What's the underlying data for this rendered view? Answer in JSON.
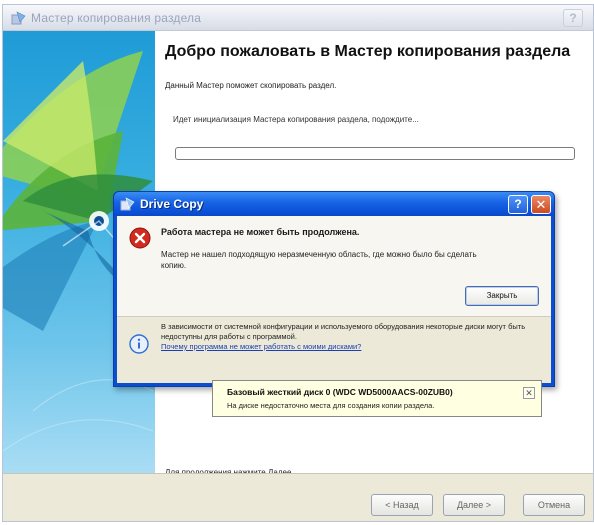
{
  "wizard": {
    "title": "Мастер копирования раздела",
    "heading": "Добро пожаловать в Мастер копирования раздела",
    "description": "Данный Мастер поможет скопировать раздел.",
    "init_status": "Идет инициализация Мастера копирования раздела, подождите...",
    "continue_text": "Для продолжения нажмите Далее",
    "help_icon": "?",
    "buttons": {
      "back": "< Назад",
      "next": "Далее >",
      "cancel": "Отмена"
    }
  },
  "dialog": {
    "title": "Drive Copy",
    "help_icon": "?",
    "close_icon": "✕",
    "error_heading": "Работа мастера не может быть продолжена.",
    "error_message": "Мастер не нашел подходящую неразмеченную область, где можно было бы сделать копию.",
    "close_button": "Закрыть",
    "info_text": "В зависимости от системной конфигурации и используемого оборудования некоторые диски могут быть недоступны для работы с программой.",
    "info_link": "Почему программа не может работать с моими дисками?"
  },
  "balloon": {
    "title": "Базовый жесткий диск 0 (WDC WD5000AACS-00ZUB0)",
    "text": "На диске недостаточно места для создания копии раздела.",
    "close_icon": "✕"
  },
  "colors": {
    "dialog_titlebar": "#0b52d8",
    "banner": "#1f9bd6",
    "balloon_bg": "#ffffe1",
    "error_red": "#d32a1f",
    "info_blue": "#2f6fd6"
  }
}
